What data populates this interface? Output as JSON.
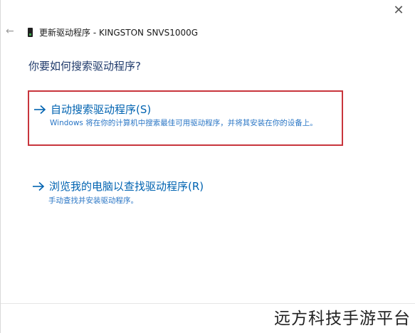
{
  "window": {
    "close_glyph": "✕",
    "back_glyph": "←",
    "title": "更新驱动程序 - KINGSTON SNVS1000G"
  },
  "heading": "你要如何搜索驱动程序?",
  "options": [
    {
      "title": "自动搜索驱动程序(S)",
      "description": "Windows 将在你的计算机中搜索最佳可用驱动程序，并将其安装在你的设备上。",
      "highlighted": true,
      "icon": "arrow-right-icon"
    },
    {
      "title": "浏览我的电脑以查找驱动程序(R)",
      "description": "手动查找并安装驱动程序。",
      "highlighted": false,
      "icon": "arrow-right-icon"
    }
  ],
  "watermark": "远方科技手游平台",
  "colors": {
    "link_blue": "#0063b1",
    "heading_blue": "#1f3a6b",
    "highlight_red": "#c8353c"
  }
}
